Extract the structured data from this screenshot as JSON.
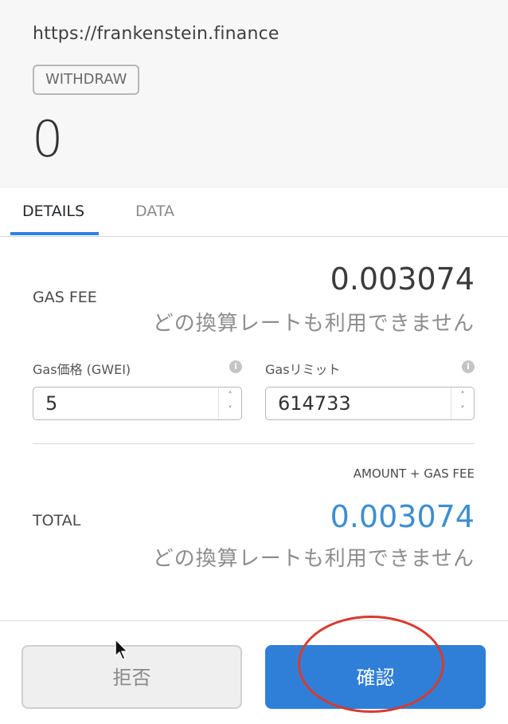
{
  "header": {
    "origin": "https://frankenstein.finance",
    "action": "WITHDRAW",
    "amount": "0"
  },
  "tabs": [
    {
      "label": "DETAILS",
      "active": true
    },
    {
      "label": "DATA",
      "active": false
    }
  ],
  "gas": {
    "label": "GAS FEE",
    "value": "0.003074",
    "fiat": "どの換算レートも利用できません",
    "price_label": "Gas価格 (GWEI)",
    "price_value": "5",
    "limit_label": "Gasリミット",
    "limit_value": "614733"
  },
  "total": {
    "subtitle": "AMOUNT + GAS FEE",
    "label": "TOTAL",
    "value": "0.003074",
    "fiat": "どの換算レートも利用できません"
  },
  "buttons": {
    "reject": "拒否",
    "confirm": "確認"
  },
  "icons": {
    "info": "i",
    "spin_up": "˄",
    "spin_down": "˅"
  },
  "colors": {
    "accent": "#2f7fd8",
    "total_value": "#3e8ed0",
    "annotation": "#d83a2e",
    "tab_underline": "#2f80ed"
  }
}
